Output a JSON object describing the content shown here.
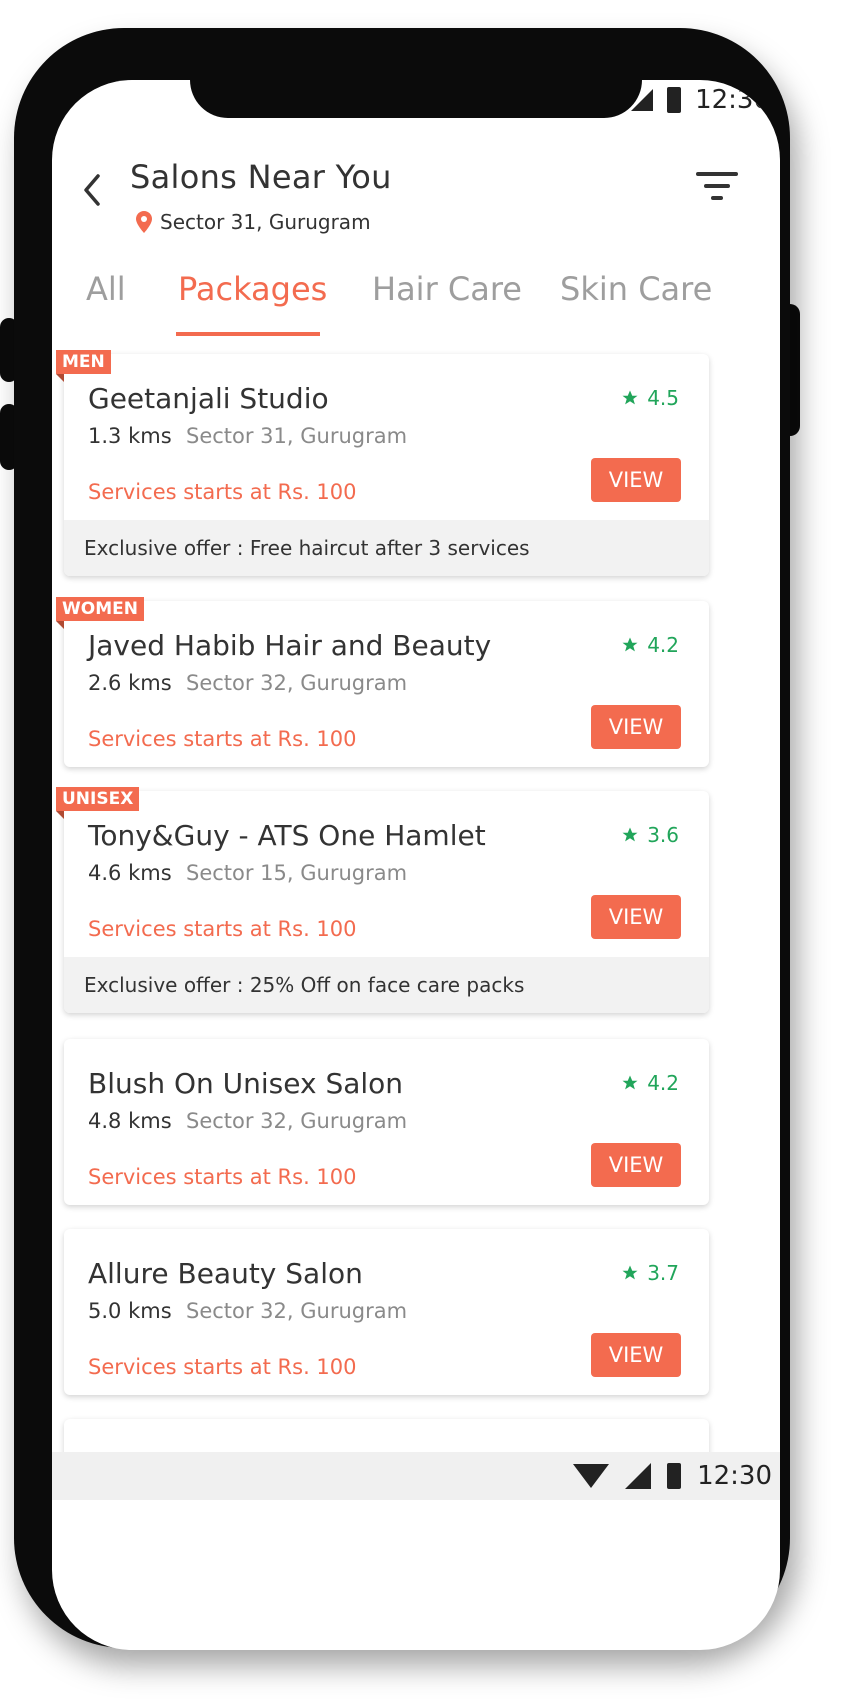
{
  "status": {
    "time": "12:30"
  },
  "header": {
    "title": "Salons Near You",
    "location": "Sector 31, Gurugram"
  },
  "tabs": [
    {
      "label": "All",
      "active": false
    },
    {
      "label": "Packages",
      "active": true
    },
    {
      "label": "Hair Care",
      "active": false
    },
    {
      "label": "Skin Care",
      "active": false
    }
  ],
  "salons": [
    {
      "tag": "MEN",
      "name": "Geetanjali Studio",
      "distance": "1.3 kms",
      "area": "Sector 31, Gurugram",
      "rating": "4.5",
      "price": "Services starts at Rs. 100",
      "button": "VIEW",
      "offer": "Exclusive offer : Free haircut after 3 services"
    },
    {
      "tag": "WOMEN",
      "name": "Javed Habib Hair and Beauty",
      "distance": "2.6 kms",
      "area": "Sector 32, Gurugram",
      "rating": "4.2",
      "price": "Services starts at Rs. 100",
      "button": "VIEW"
    },
    {
      "tag": "UNISEX",
      "name": "Tony&Guy - ATS One Hamlet",
      "distance": "4.6 kms",
      "area": "Sector 15, Gurugram",
      "rating": "3.6",
      "price": "Services starts at Rs. 100",
      "button": "VIEW",
      "offer": "Exclusive offer : 25% Off on face care packs"
    },
    {
      "name": "Blush On Unisex Salon",
      "distance": "4.8 kms",
      "area": "Sector 32, Gurugram",
      "rating": "4.2",
      "price": "Services starts at Rs. 100",
      "button": "VIEW"
    },
    {
      "name": "Allure Beauty Salon",
      "distance": "5.0 kms",
      "area": "Sector 32, Gurugram",
      "rating": "3.7",
      "price": "Services starts at Rs. 100",
      "button": "VIEW"
    }
  ],
  "colors": {
    "accent": "#f36b4f",
    "rating": "#21a55a",
    "offer_bg": "#f2f2f2"
  },
  "icons": {
    "back": "chevron-left-icon",
    "location": "location-pin-icon",
    "filter": "filter-icon",
    "star": "star-icon"
  }
}
